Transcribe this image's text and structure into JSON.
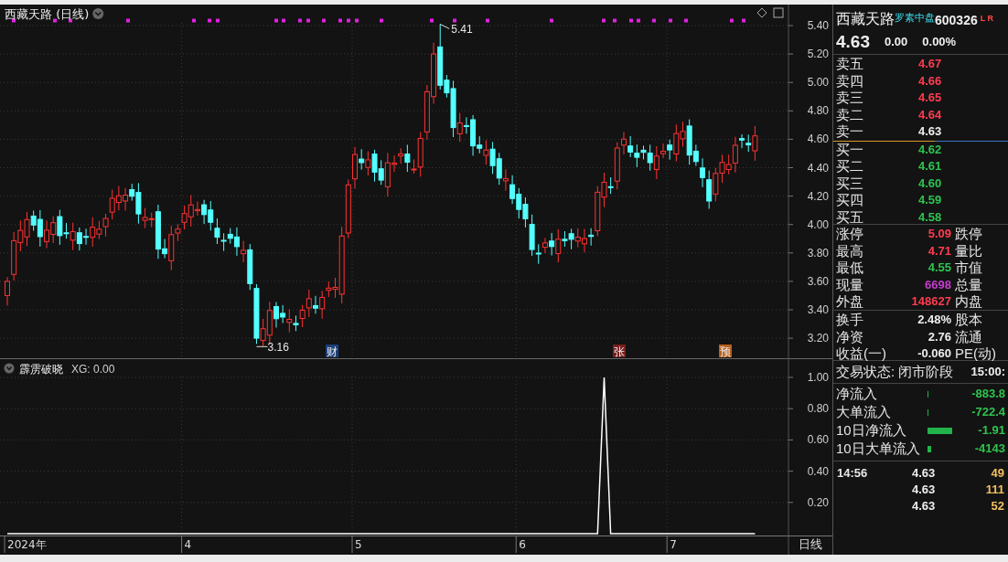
{
  "chart_header": {
    "title": "西藏天路 (日线)"
  },
  "price_axis": [
    "5.40",
    "5.20",
    "5.00",
    "4.80",
    "4.60",
    "4.40",
    "4.20",
    "4.00",
    "3.80",
    "3.60",
    "3.40",
    "3.20"
  ],
  "price_marks": [
    {
      "kind": "high",
      "text": "5.41"
    },
    {
      "kind": "low",
      "text": "3.16"
    }
  ],
  "event_tags": [
    {
      "text": "财",
      "color": "#1c3f78"
    },
    {
      "text": "张",
      "color": "#7a1e1e"
    },
    {
      "text": "预",
      "color": "#b8601c"
    }
  ],
  "indicator": {
    "title": "霹雳破晓",
    "reading": "XG: 0.00",
    "chart_data": {
      "type": "line",
      "grid": true,
      "series": [
        {
          "color": "#ffffff",
          "values": [
            0,
            0,
            0,
            0,
            0,
            0,
            0,
            0,
            0,
            0,
            0,
            0,
            0,
            0,
            0,
            0,
            0,
            0,
            0,
            0,
            0,
            0,
            0,
            0,
            0,
            0,
            0,
            0,
            0,
            0,
            0,
            0,
            0,
            0,
            0,
            0,
            0,
            0,
            0,
            0,
            0,
            0,
            0,
            0,
            0,
            0,
            0,
            0,
            0,
            0,
            0,
            0,
            0,
            0,
            0,
            0,
            0,
            0,
            0,
            0,
            0,
            0,
            0,
            0,
            0,
            0,
            0,
            0,
            0,
            0,
            0,
            0,
            0,
            0,
            0,
            0,
            0,
            0,
            0,
            0,
            0,
            0,
            0,
            0,
            0,
            0,
            0,
            0,
            0,
            0,
            0,
            1,
            0,
            0,
            0,
            0,
            0,
            0,
            0,
            0,
            0,
            0,
            0,
            0,
            0,
            0,
            0,
            0,
            0,
            0,
            0,
            0,
            0,
            0,
            0
          ]
        }
      ],
      "ylim": [
        0,
        1
      ],
      "yticks": [
        {
          "value": 0.2,
          "label": "0.20"
        },
        {
          "value": 0.4,
          "label": "0.40"
        },
        {
          "value": 0.6,
          "label": "0.60"
        },
        {
          "value": 0.8,
          "label": "0.80"
        },
        {
          "value": 1,
          "label": "1.00"
        }
      ]
    }
  },
  "date_axis": [
    "2024年",
    "4",
    "5",
    "6",
    "7"
  ],
  "period_label": "日线",
  "quote": {
    "name": "西藏天路",
    "board": "罗素中盘",
    "code": "600326",
    "flags": "L R",
    "price": "4.63",
    "change": "0.00",
    "change_pct": "0.00%"
  },
  "order_book": [
    {
      "label": "卖五",
      "price": "4.67",
      "color": "#ff3c50"
    },
    {
      "label": "卖四",
      "price": "4.66",
      "color": "#ff3c50"
    },
    {
      "label": "卖三",
      "price": "4.65",
      "color": "#ff3c50"
    },
    {
      "label": "卖二",
      "price": "4.64",
      "color": "#ff3c50"
    },
    {
      "label": "卖一",
      "price": "4.63",
      "color": "#eeeeee"
    },
    {
      "label": "买一",
      "price": "4.62",
      "color": "#2fc34f"
    },
    {
      "label": "买二",
      "price": "4.61",
      "color": "#2fc34f"
    },
    {
      "label": "买三",
      "price": "4.60",
      "color": "#2fc34f"
    },
    {
      "label": "买四",
      "price": "4.59",
      "color": "#2fc34f"
    },
    {
      "label": "买五",
      "price": "4.58",
      "color": "#2fc34f"
    }
  ],
  "stats": [
    {
      "label": "涨停",
      "value": "5.09",
      "color": "#ff3c50",
      "label2": "跌停"
    },
    {
      "label": "最高",
      "value": "4.71",
      "color": "#ff3c50",
      "label2": "量比"
    },
    {
      "label": "最低",
      "value": "4.55",
      "color": "#2fc34f",
      "label2": "市值"
    },
    {
      "label": "现量",
      "value": "6698",
      "color": "#c63ccf",
      "label2": "总量"
    },
    {
      "label": "外盘",
      "value": "148627",
      "color": "#ff3c50",
      "label2": "内盘"
    }
  ],
  "fundamentals": [
    {
      "label": "换手",
      "value": "2.48%",
      "label2": "股本"
    },
    {
      "label": "净资",
      "value": "2.76",
      "label2": "流通"
    },
    {
      "label": "收益(一)",
      "value": "-0.060",
      "label2": "PE(动)"
    }
  ],
  "trade_status": {
    "label": "交易状态:",
    "value": "闭市阶段",
    "time": "15:00:"
  },
  "fund_flows": [
    {
      "label": "净流入",
      "value": "-883.8"
    },
    {
      "label": "大单流入",
      "value": "-722.4"
    },
    {
      "label": "10日净流入",
      "value": "-1.91"
    },
    {
      "label": "10日大单流入",
      "value": "-4143"
    }
  ],
  "ticks": [
    {
      "time": "14:56",
      "price": "4.63",
      "volume": "49"
    },
    {
      "price": "4.63",
      "volume": "111"
    },
    {
      "price": "4.63",
      "volume": "52"
    }
  ]
}
